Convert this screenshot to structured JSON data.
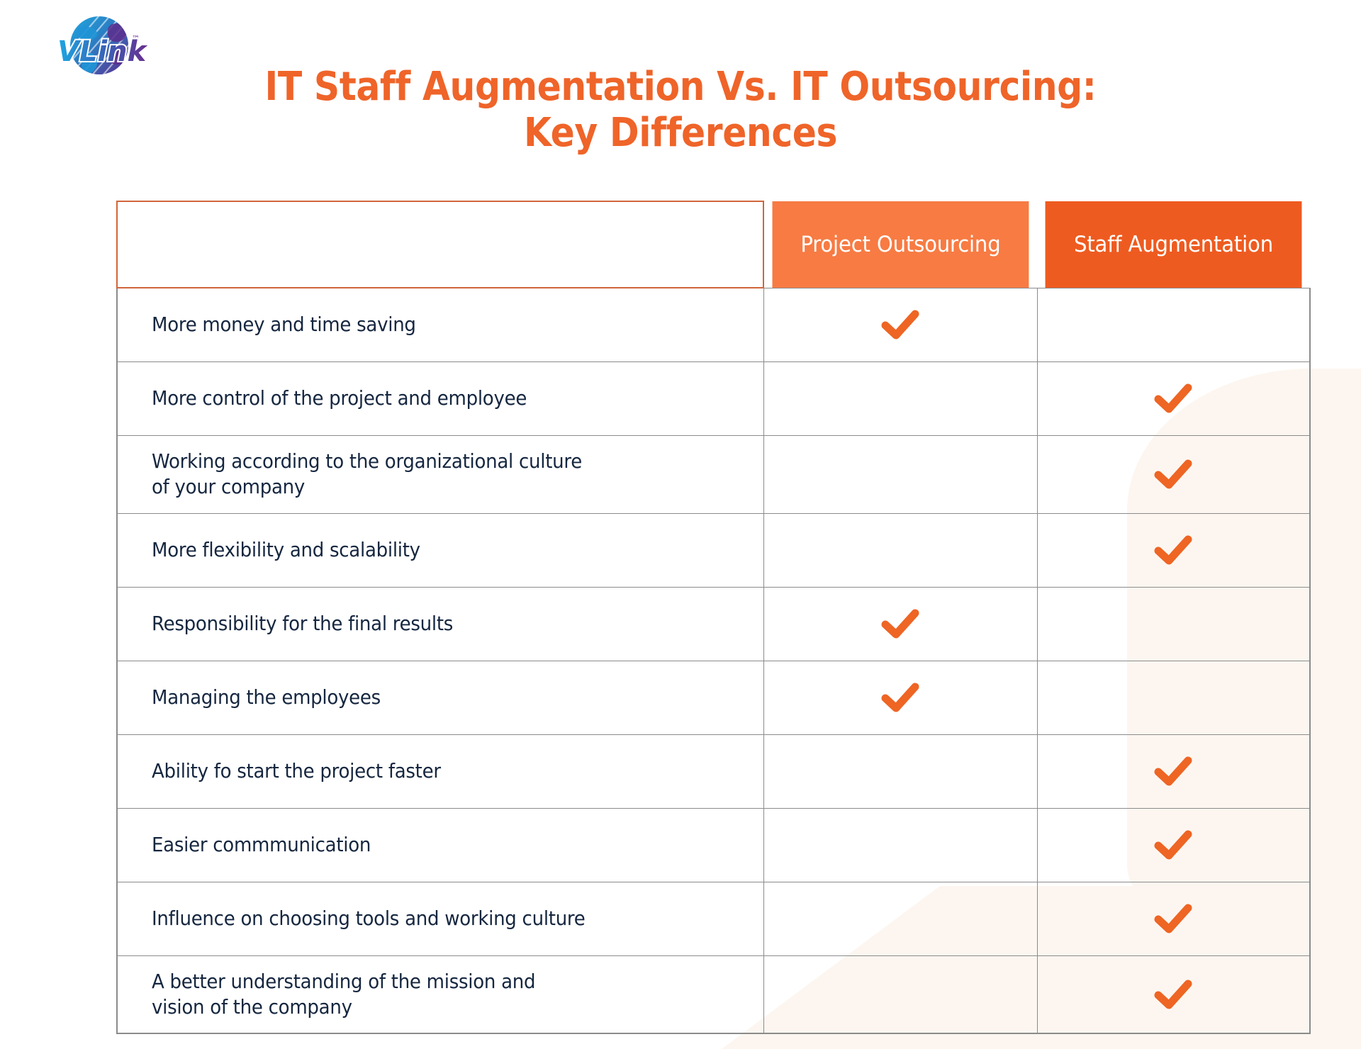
{
  "brand": {
    "logo_name": "vlink-globe-logo",
    "wordmark": "VLink",
    "trademark": "™"
  },
  "title": {
    "line1": "IT Staff Augmentation Vs. IT Outsourcing:",
    "line2": "Key Differences"
  },
  "colors": {
    "title_orange": "#ef6429",
    "header_light_orange": "#f77b43",
    "header_dark_orange": "#ee5b20",
    "check_orange": "#ee6524",
    "row_text_navy": "#15263f",
    "grid_gray": "#8b8b8b",
    "blank_header_border": "#d1663a",
    "decor_cream": "#fdf6f0"
  },
  "table": {
    "blank_header_label": "",
    "columns": [
      {
        "key": "project_outsourcing",
        "label": "Project Outsourcing"
      },
      {
        "key": "staff_augmentation",
        "label": "Staff Augmentation"
      }
    ],
    "check_icon_name": "orange-checkmark-icon",
    "rows": [
      {
        "feature": "More money and time saving",
        "project_outsourcing": true,
        "staff_augmentation": false
      },
      {
        "feature": "More control of the project and employee",
        "project_outsourcing": false,
        "staff_augmentation": true
      },
      {
        "feature": "Working according to the organizational culture\nof your company",
        "project_outsourcing": false,
        "staff_augmentation": true
      },
      {
        "feature": "More flexibility and scalability",
        "project_outsourcing": false,
        "staff_augmentation": true
      },
      {
        "feature": "Responsibility for the final results",
        "project_outsourcing": true,
        "staff_augmentation": false
      },
      {
        "feature": "Managing the employees",
        "project_outsourcing": true,
        "staff_augmentation": false
      },
      {
        "feature": "Ability fo start the project faster",
        "project_outsourcing": false,
        "staff_augmentation": true
      },
      {
        "feature": "Easier commmunication",
        "project_outsourcing": false,
        "staff_augmentation": true
      },
      {
        "feature": "Influence on choosing tools and working culture",
        "project_outsourcing": false,
        "staff_augmentation": true
      },
      {
        "feature": "A better understanding of the mission and\nvision of the company",
        "project_outsourcing": false,
        "staff_augmentation": true
      }
    ]
  }
}
